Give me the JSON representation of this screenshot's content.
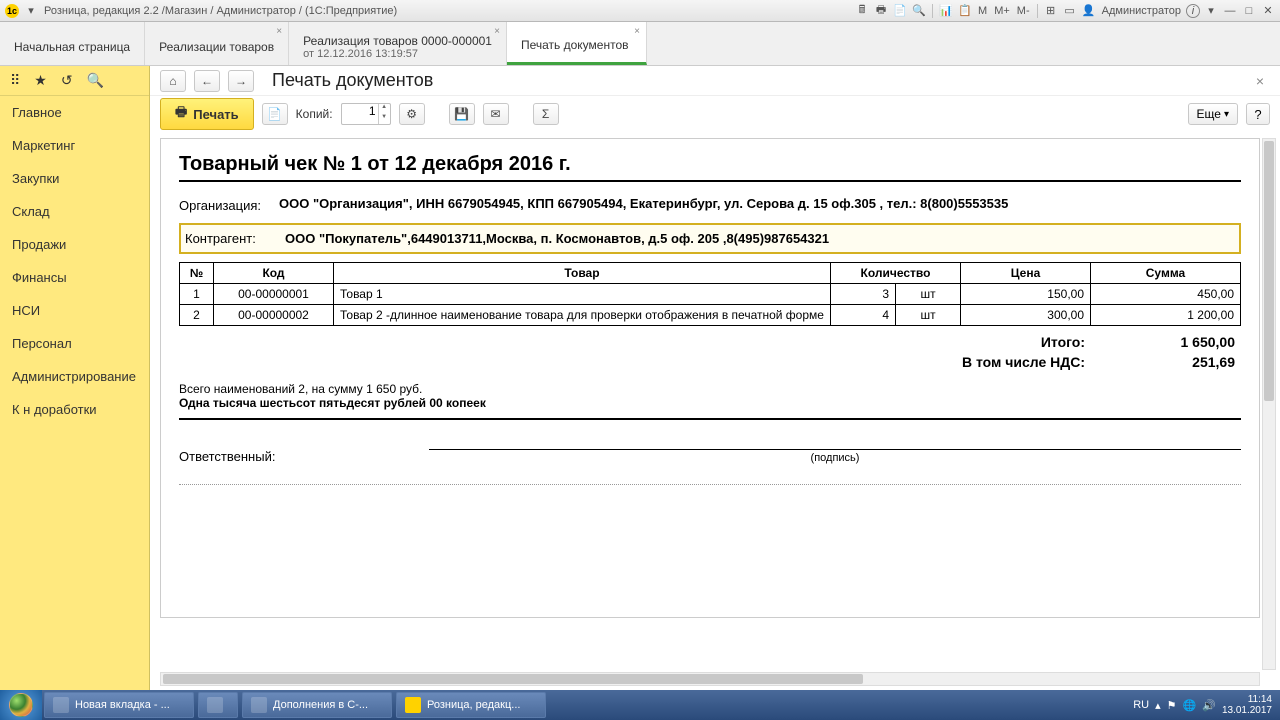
{
  "titlebar": {
    "title": "Розница, редакция 2.2 /Магазин / Администратор / (1С:Предприятие)",
    "m": "M",
    "mplus": "M+",
    "mminus": "M-",
    "admin": "Администратор",
    "i": "i"
  },
  "tabs": [
    {
      "label": "Начальная страница"
    },
    {
      "label": "Реализации товаров"
    },
    {
      "label": "Реализация товаров 0000-000001",
      "sub": "от 12.12.2016 13:19:57"
    },
    {
      "label": "Печать документов"
    }
  ],
  "nav": [
    "Главное",
    "Маркетинг",
    "Закупки",
    "Склад",
    "Продажи",
    "Финансы",
    "НСИ",
    "Персонал",
    "Администрирование",
    "К н доработки"
  ],
  "content": {
    "title": "Печать документов",
    "print": "Печать",
    "copies_label": "Копий:",
    "copies_value": "1",
    "eshe": "Еще",
    "help": "?"
  },
  "doc": {
    "title": "Товарный чек № 1 от 12 декабря 2016 г.",
    "org_label": "Организация:",
    "org_value": "ООО \"Организация\", ИНН 6679054945, КПП 667905494, Екатеринбург, ул. Серова д. 15 оф.305 , тел.: 8(800)5553535",
    "kontr_label": "Контрагент:",
    "kontr_value": "ООО \"Покупатель\",6449013711,Москва, п. Космонавтов, д.5 оф. 205 ,8(495)987654321",
    "headers": {
      "n": "№",
      "kod": "Код",
      "tovar": "Товар",
      "qty": "Количество",
      "price": "Цена",
      "sum": "Сумма"
    },
    "rows": [
      {
        "n": "1",
        "kod": "00-00000001",
        "tovar": "Товар 1",
        "qty": "3",
        "unit": "шт",
        "price": "150,00",
        "sum": "450,00"
      },
      {
        "n": "2",
        "kod": "00-00000002",
        "tovar": "Товар 2 -длинное наименование товара для проверки отображения в печатной форме",
        "qty": "4",
        "unit": "шт",
        "price": "300,00",
        "sum": "1 200,00"
      }
    ],
    "total_label": "Итого:",
    "total_value": "1 650,00",
    "nds_label": "В том числе НДС:",
    "nds_value": "251,69",
    "summary": "Всего наименований 2, на сумму 1 650 руб.",
    "summary_text": "Одна тысяча шестьсот пятьдесят рублей 00 копеек",
    "resp": "Ответственный:",
    "sign": "(подпись)"
  },
  "taskbar": {
    "items": [
      {
        "label": "Новая вкладка - ..."
      },
      {
        "label": ""
      },
      {
        "label": "Дополнения в С-..."
      },
      {
        "label": "Розница, редакц..."
      }
    ],
    "lang": "RU",
    "time": "11:14",
    "date": "13.01.2017"
  }
}
